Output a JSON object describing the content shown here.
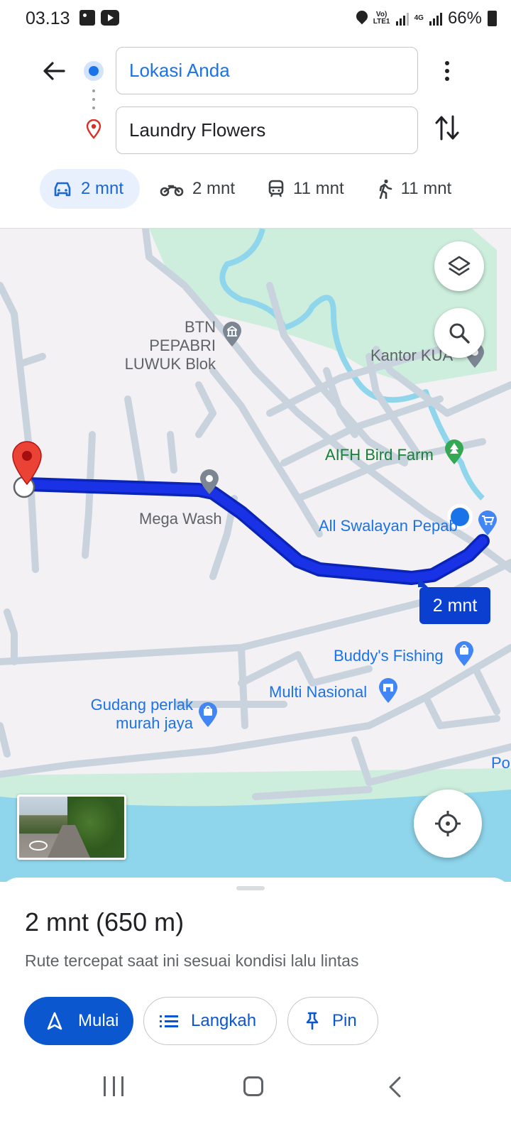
{
  "status_bar": {
    "time": "03.13",
    "lte_label": "Vo) LTE1",
    "net_label": "4G",
    "battery": "66%"
  },
  "header": {
    "origin_value": "Lokasi Anda",
    "destination_value": "Laundry Flowers",
    "modes": [
      {
        "icon": "car-icon",
        "label": "2 mnt",
        "selected": true
      },
      {
        "icon": "motorcycle-icon",
        "label": "2 mnt",
        "selected": false
      },
      {
        "icon": "transit-icon",
        "label": "11 mnt",
        "selected": false
      },
      {
        "icon": "walk-icon",
        "label": "11 mnt",
        "selected": false
      }
    ]
  },
  "map": {
    "pois": {
      "btn_pepabri": "BTN PEPABRI\nLUWUK Blok",
      "kantor_kua": "Kantor KUA",
      "aifh": "AIFH Bird Farm",
      "mega_wash": "Mega Wash",
      "all_swalayan": "All Swalayan Pepab",
      "buddys": "Buddy's Fishing",
      "multi_nasional": "Multi Nasional",
      "gudang": "Gudang perlak\nmurah jaya",
      "edge_label": "Po"
    },
    "route_badge": "2 mnt",
    "colors": {
      "route": "#1a32e6",
      "water": "#8fd6ec",
      "park": "#cdeedd",
      "road": "#c9d3dd"
    }
  },
  "sheet": {
    "summary": "2 mnt (650 m)",
    "description": "Rute tercepat saat ini sesuai kondisi lalu lintas",
    "start_label": "Mulai",
    "steps_label": "Langkah",
    "pin_label": "Pin"
  }
}
